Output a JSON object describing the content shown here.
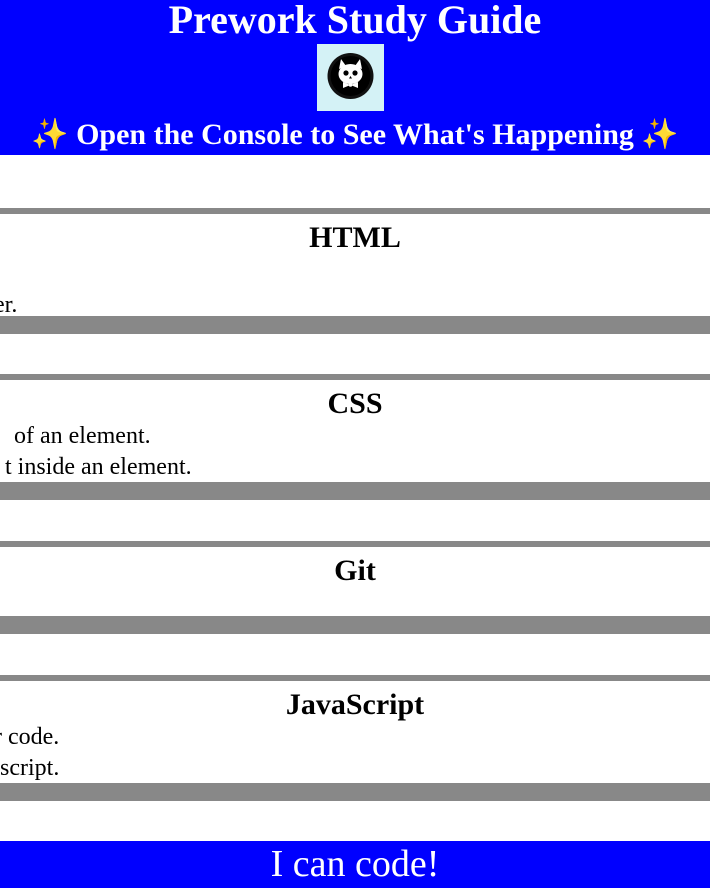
{
  "header": {
    "title": "Prework Study Guide",
    "logo_icon": "cat-skull-icon",
    "subtitle_text": "Open the Console to See What's Happening",
    "sparkle_left": "✨",
    "sparkle_right": "✨",
    "background_color": "#0000ff"
  },
  "sections": [
    {
      "title": "HTML",
      "lines": [
        "er."
      ]
    },
    {
      "title": "CSS",
      "lines": [
        "of an element.",
        "t inside an element."
      ]
    },
    {
      "title": "Git",
      "lines": []
    },
    {
      "title": "JavaScript",
      "lines": [
        "r code.",
        " script."
      ]
    }
  ],
  "footer": {
    "text": "I can code!"
  }
}
